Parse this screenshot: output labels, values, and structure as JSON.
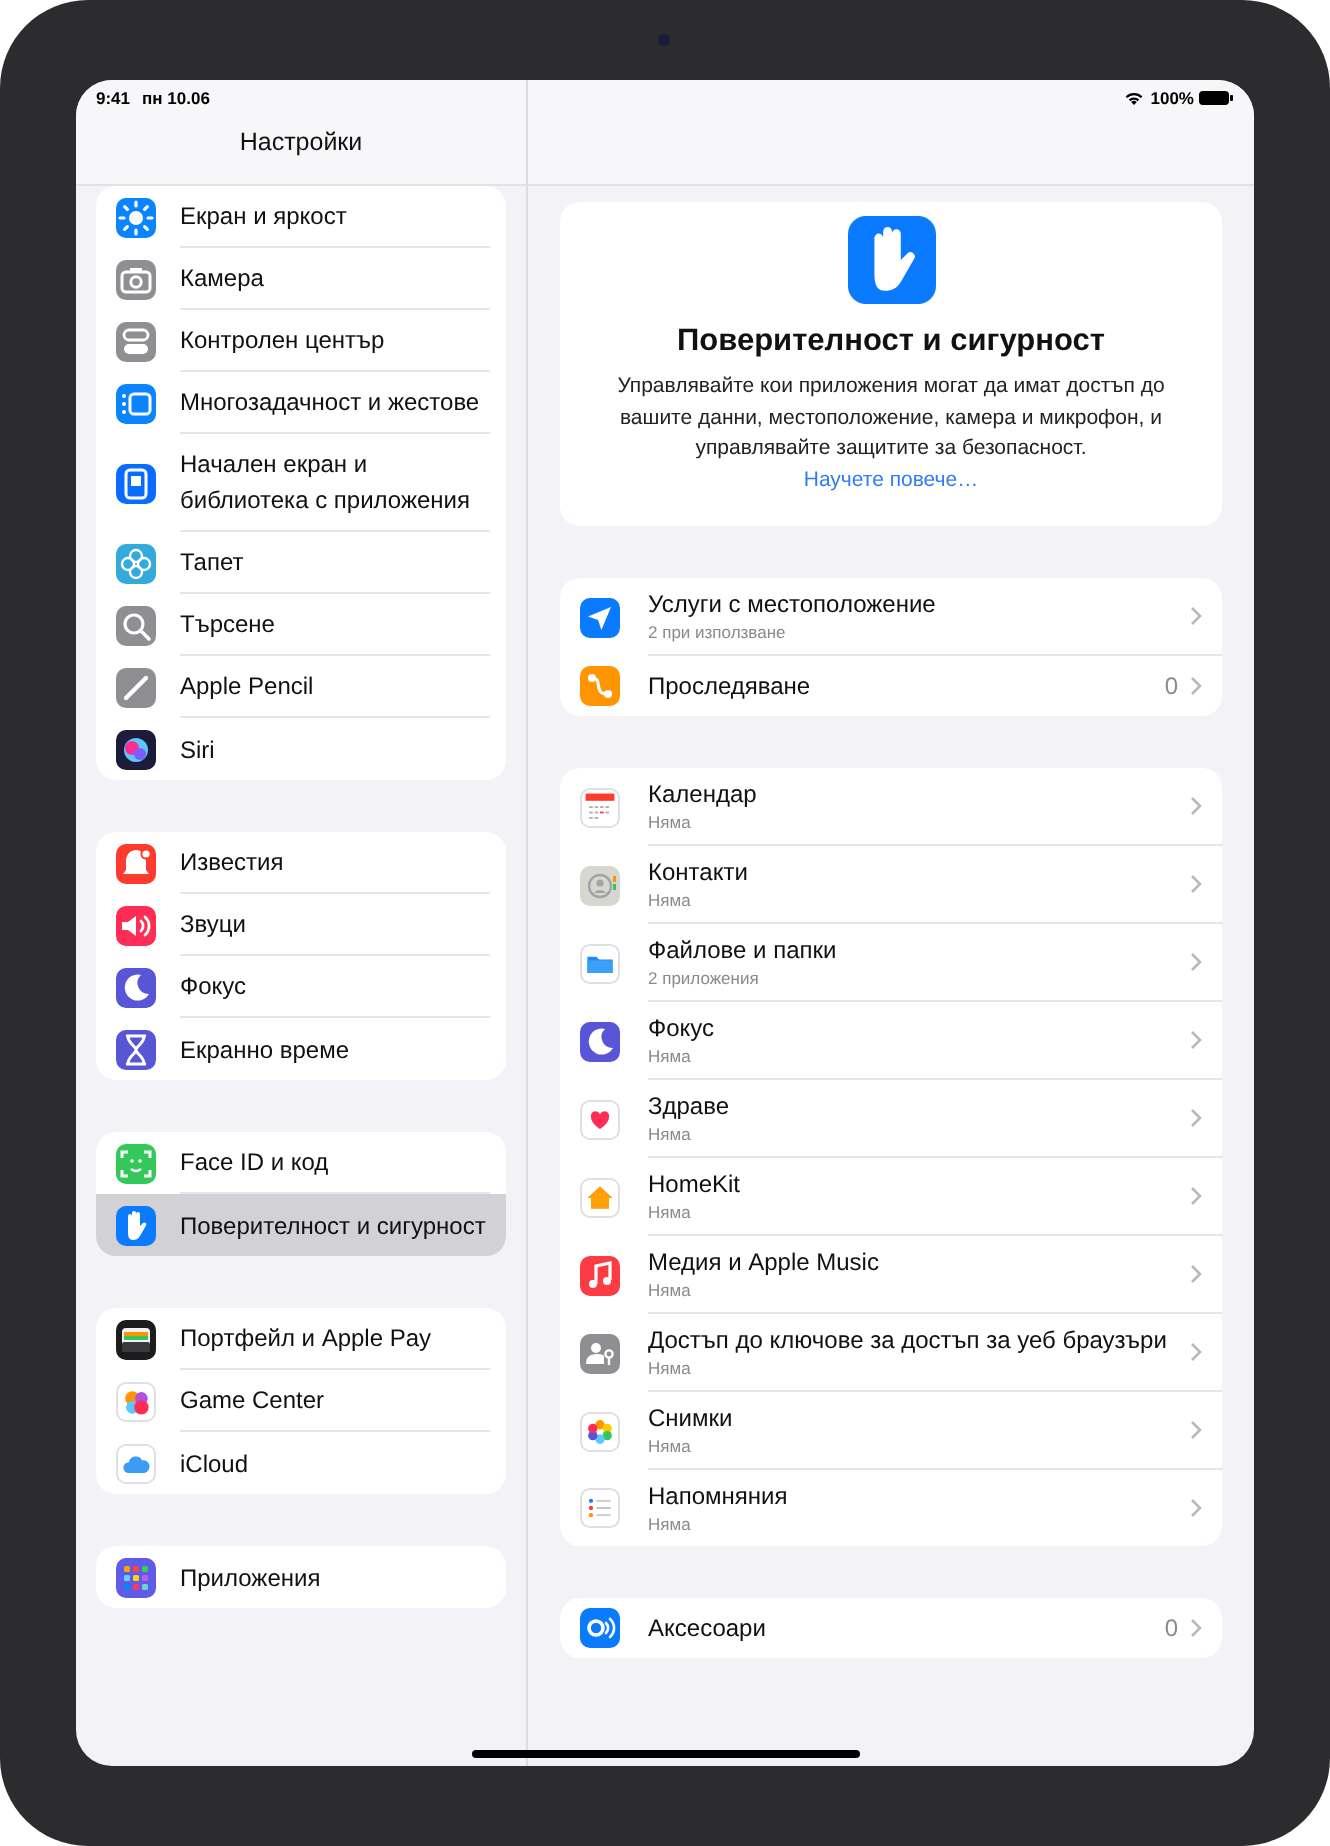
{
  "status_bar": {
    "time": "9:41",
    "date": "пн 10.06",
    "battery": "100%"
  },
  "sidebar": {
    "title": "Настройки",
    "groups": [
      {
        "items": [
          {
            "label": "Екран и яркост",
            "selected": false
          },
          {
            "label": "Камера",
            "selected": false
          },
          {
            "label": "Контролен център",
            "selected": false
          },
          {
            "label": "Многозадачност и жестове",
            "selected": false
          },
          {
            "label": "Начален екран и библиотека с приложения",
            "selected": false
          },
          {
            "label": "Тапет",
            "selected": false
          },
          {
            "label": "Търсене",
            "selected": false
          },
          {
            "label": "Apple Pencil",
            "selected": false
          },
          {
            "label": "Siri",
            "selected": false
          }
        ]
      },
      {
        "items": [
          {
            "label": "Известия",
            "selected": false
          },
          {
            "label": "Звуци",
            "selected": false
          },
          {
            "label": "Фокус",
            "selected": false
          },
          {
            "label": "Екранно време",
            "selected": false
          }
        ]
      },
      {
        "items": [
          {
            "label": "Face ID и код",
            "selected": false
          },
          {
            "label": "Поверителност и сигурност",
            "selected": true
          }
        ]
      },
      {
        "items": [
          {
            "label": "Портфейл и Apple Pay",
            "selected": false
          },
          {
            "label": "Game Center",
            "selected": false
          },
          {
            "label": "iCloud",
            "selected": false
          }
        ]
      },
      {
        "items": [
          {
            "label": "Приложения",
            "selected": false
          }
        ]
      }
    ]
  },
  "detail": {
    "header": {
      "title": "Поверителност и сигурност",
      "description": "Управлявайте кои приложения могат да имат достъп до вашите данни, местоположение, камера и микрофон, и управлявайте защитите за безопасност.",
      "link": "Научете повече…"
    },
    "groups": [
      {
        "rows": [
          {
            "title": "Услуги с местоположение",
            "subtitle": "2 при използване"
          },
          {
            "title": "Проследяване",
            "count": "0"
          }
        ]
      },
      {
        "rows": [
          {
            "title": "Календар",
            "subtitle": "Няма"
          },
          {
            "title": "Контакти",
            "subtitle": "Няма"
          },
          {
            "title": "Файлове и папки",
            "subtitle": "2 приложения"
          },
          {
            "title": "Фокус",
            "subtitle": "Няма"
          },
          {
            "title": "Здраве",
            "subtitle": "Няма"
          },
          {
            "title": "HomeKit",
            "subtitle": "Няма"
          },
          {
            "title": "Медия и Apple Music",
            "subtitle": "Няма"
          },
          {
            "title": "Достъп до ключове за достъп за уеб браузъри",
            "subtitle": "Няма"
          },
          {
            "title": "Снимки",
            "subtitle": "Няма"
          },
          {
            "title": "Напомняния",
            "subtitle": "Няма"
          }
        ]
      },
      {
        "rows": [
          {
            "title": "Аксесоари",
            "count": "0"
          }
        ]
      }
    ]
  }
}
